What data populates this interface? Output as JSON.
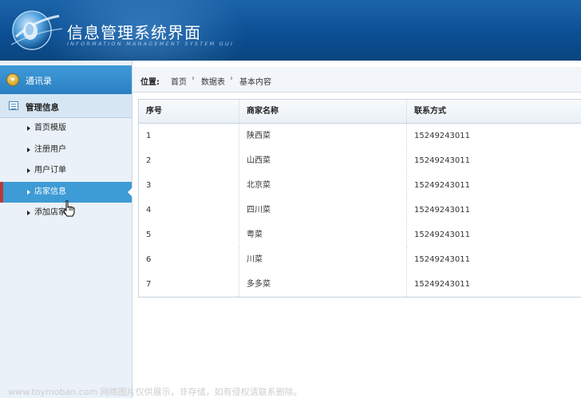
{
  "header": {
    "title": "信息管理系统界面",
    "subtitle": "INFORMATION MANAGEMENT SYSTEM GUI",
    "logo_icon": "globe-logo-icon"
  },
  "sidebar": {
    "top_label": "通讯录",
    "section_label": "管理信息",
    "items": [
      {
        "label": "首页模版",
        "active": false
      },
      {
        "label": "注册用户",
        "active": false
      },
      {
        "label": "用户订单",
        "active": false
      },
      {
        "label": "店家信息",
        "active": true
      },
      {
        "label": "添加店家",
        "active": false
      }
    ]
  },
  "breadcrumb": {
    "position_label": "位置:",
    "items": [
      "首页",
      "数据表",
      "基本内容"
    ]
  },
  "table": {
    "headers": [
      "序号",
      "商家名称",
      "联系方式"
    ],
    "rows": [
      [
        "1",
        "陕西菜",
        "15249243011"
      ],
      [
        "2",
        "山西菜",
        "15249243011"
      ],
      [
        "3",
        "北京菜",
        "15249243011"
      ],
      [
        "4",
        "四川菜",
        "15249243011"
      ],
      [
        "5",
        "粤菜",
        "15249243011"
      ],
      [
        "6",
        "川菜",
        "15249243011"
      ],
      [
        "7",
        "多多菜",
        "15249243011"
      ]
    ]
  },
  "watermark": "www.toymoban.com 网络图片仅供展示，非存储，如有侵权请联系删除。",
  "colors": {
    "header_bg": "#0c4f94",
    "sidebar_bg": "#eaf1f8",
    "active_item_bg": "#3d9bd6",
    "active_marker": "#b73a3a"
  }
}
